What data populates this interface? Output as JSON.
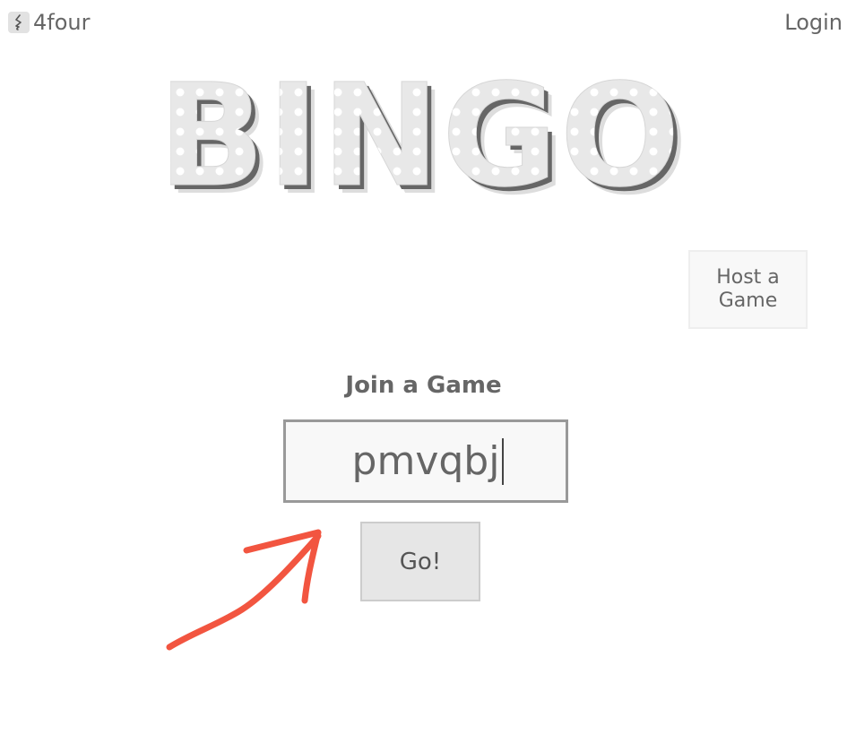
{
  "header": {
    "brand_name": "4four",
    "brand_icon": "music-note-icon",
    "login_label": "Login"
  },
  "title": {
    "text": "BINGO",
    "fill_color": "#e8e8e8",
    "shadow_color": "#666666",
    "dot_color": "#ffffff"
  },
  "host": {
    "label": "Host a Game"
  },
  "join": {
    "heading": "Join a Game",
    "code_value": "pmvqbj",
    "go_label": "Go!"
  },
  "annotation": {
    "icon": "arrow-icon",
    "color": "#f25540"
  }
}
